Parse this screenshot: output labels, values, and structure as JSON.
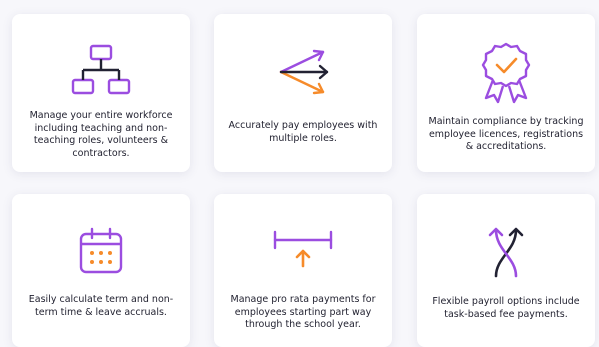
{
  "colors": {
    "purple": "#9b4de0",
    "orange": "#f68b2a",
    "dark": "#222233"
  },
  "cards": [
    {
      "icon": "org-chart-icon",
      "text": "Manage your entire workforce including teaching and non-teaching roles, volunteers & contractors."
    },
    {
      "icon": "split-arrows-icon",
      "text": "Accurately pay employees with multiple roles."
    },
    {
      "icon": "award-ribbon-icon",
      "text": "Maintain compliance by tracking employee licences, registrations & accreditations."
    },
    {
      "icon": "calendar-icon",
      "text": "Easily calculate term and non-term time & leave accruals."
    },
    {
      "icon": "pro-rata-range-icon",
      "text": "Manage pro rata payments for employees starting part way through the school year."
    },
    {
      "icon": "crossing-paths-icon",
      "text": "Flexible payroll options include task-based fee payments."
    }
  ]
}
